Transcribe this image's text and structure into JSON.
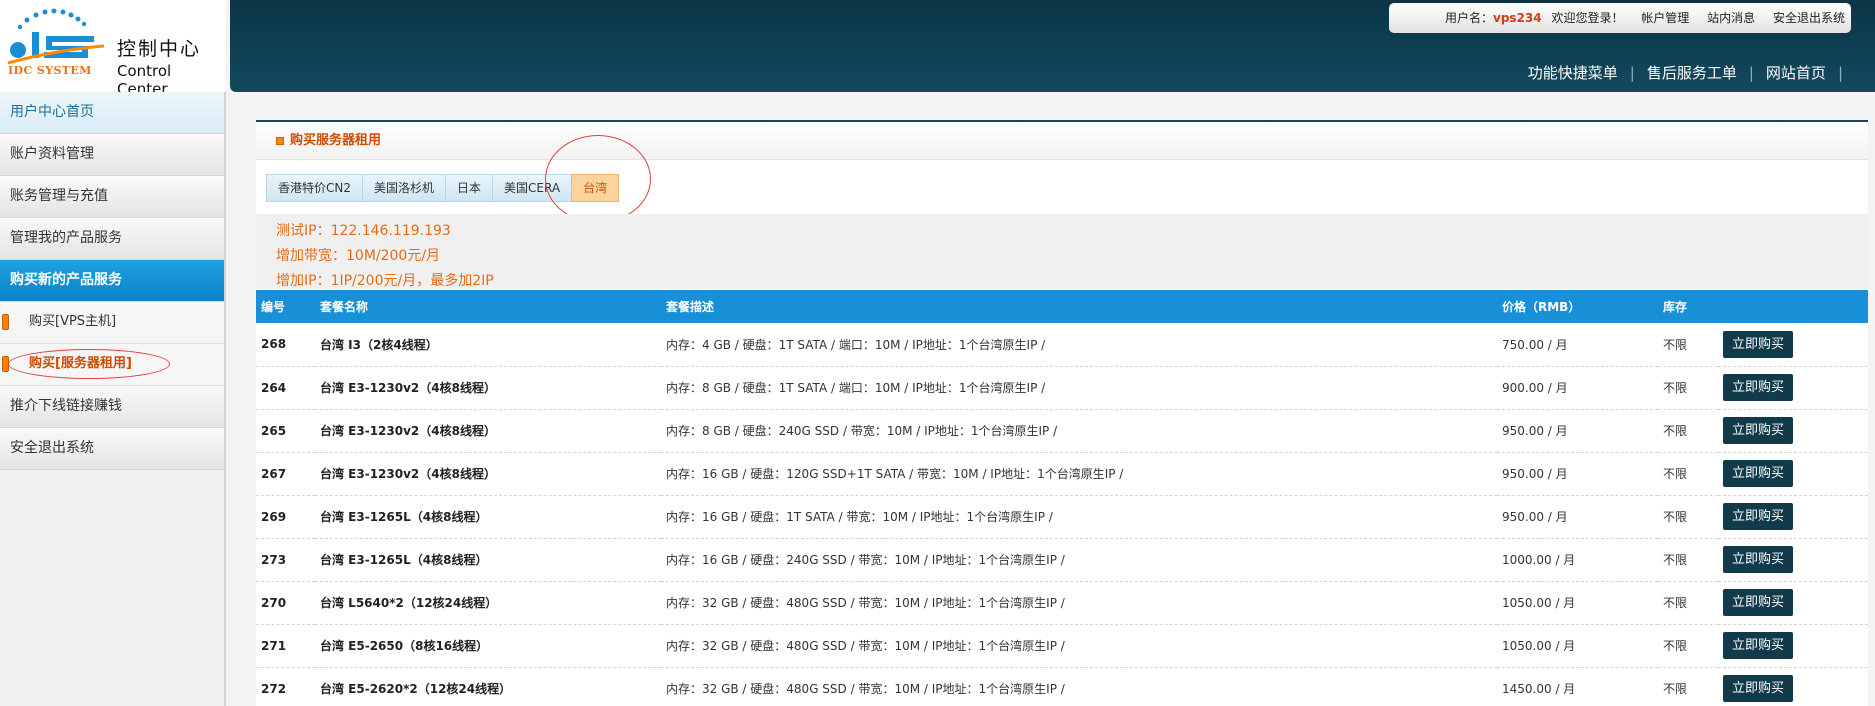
{
  "logo": {
    "brand_text": "IDC SYSTEM",
    "title_cn": "控制中心",
    "title_en": "Control Center"
  },
  "user_bar": {
    "username_label": "用户名：",
    "username": "vps234",
    "welcome": "欢迎您登录！",
    "links": [
      "帐户管理",
      "站内消息",
      "安全退出系统"
    ]
  },
  "quick_nav": [
    "功能快捷菜单",
    "售后服务工单",
    "网站首页"
  ],
  "sidebar": {
    "items": [
      {
        "label": "用户中心首页"
      },
      {
        "label": "账户资料管理"
      },
      {
        "label": "账务管理与充值"
      },
      {
        "label": "管理我的产品服务"
      },
      {
        "label": "购买新的产品服务"
      },
      {
        "label": "购买[VPS主机]"
      },
      {
        "label": "购买[服务器租用]"
      },
      {
        "label": "推介下线链接赚钱"
      },
      {
        "label": "安全退出系统"
      }
    ]
  },
  "panel": {
    "title": "购买服务器租用",
    "tabs": [
      "香港特价CN2",
      "美国洛杉机",
      "日本",
      "美国CERA",
      "台湾"
    ],
    "active_tab": "台湾",
    "info_lines": [
      "测试IP：122.146.119.193",
      "增加带宽：10M/200元/月",
      "增加IP：1IP/200元/月，最多加2IP"
    ]
  },
  "table": {
    "headers": [
      "编号",
      "套餐名称",
      "套餐描述",
      "价格（RMB）",
      "库存",
      ""
    ],
    "buy_label": "立即购买",
    "rows": [
      {
        "id": "268",
        "name": "台湾 I3（2核4线程）",
        "desc": "内存：4 GB / 硬盘：1T SATA / 端口：10M / IP地址：1个台湾原生IP /",
        "price": "750.00 / 月",
        "stock": "不限"
      },
      {
        "id": "264",
        "name": "台湾 E3-1230v2（4核8线程）",
        "desc": "内存：8 GB / 硬盘：1T SATA / 端口：10M / IP地址：1个台湾原生IP /",
        "price": "900.00 / 月",
        "stock": "不限"
      },
      {
        "id": "265",
        "name": "台湾 E3-1230v2（4核8线程）",
        "desc": "内存：8 GB / 硬盘：240G SSD / 带宽：10M / IP地址：1个台湾原生IP /",
        "price": "950.00 / 月",
        "stock": "不限"
      },
      {
        "id": "267",
        "name": "台湾 E3-1230v2（4核8线程）",
        "desc": "内存：16 GB / 硬盘：120G SSD+1T SATA / 带宽：10M / IP地址：1个台湾原生IP /",
        "price": "950.00 / 月",
        "stock": "不限"
      },
      {
        "id": "269",
        "name": "台湾 E3-1265L（4核8线程）",
        "desc": "内存：16 GB / 硬盘：1T SATA / 带宽：10M / IP地址：1个台湾原生IP /",
        "price": "950.00 / 月",
        "stock": "不限"
      },
      {
        "id": "273",
        "name": "台湾 E3-1265L（4核8线程）",
        "desc": "内存：16 GB / 硬盘：240G SSD / 带宽：10M / IP地址：1个台湾原生IP /",
        "price": "1000.00 / 月",
        "stock": "不限"
      },
      {
        "id": "270",
        "name": "台湾 L5640*2（12核24线程）",
        "desc": "内存：32 GB / 硬盘：480G SSD / 带宽：10M / IP地址：1个台湾原生IP /",
        "price": "1050.00 / 月",
        "stock": "不限"
      },
      {
        "id": "271",
        "name": "台湾 E5-2650（8核16线程）",
        "desc": "内存：32 GB / 硬盘：480G SSD / 带宽：10M / IP地址：1个台湾原生IP /",
        "price": "1050.00 / 月",
        "stock": "不限"
      },
      {
        "id": "272",
        "name": "台湾 E5-2620*2（12核24线程）",
        "desc": "内存：32 GB / 硬盘：480G SSD / 带宽：10M / IP地址：1个台湾原生IP /",
        "price": "1450.00 / 月",
        "stock": "不限"
      }
    ]
  },
  "colors": {
    "header_bg": "#0b3446",
    "accent_blue": "#1890d8",
    "accent_orange": "#e86b16",
    "buy_button": "#113a4b"
  }
}
